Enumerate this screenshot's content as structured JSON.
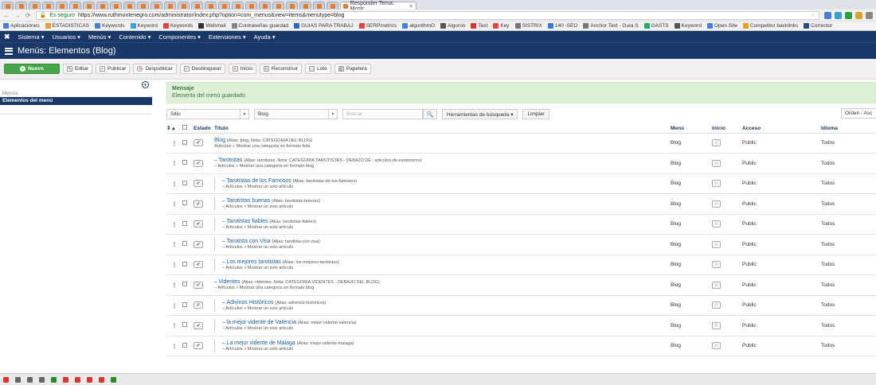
{
  "browser": {
    "active_tab": "Responder Tema: Mostr",
    "url_secure": "Es seguro",
    "url": "https://www.ruthmontenegro.com/administrator/index.php?option=com_menus&view=items&menutype=blog",
    "bookmarks": [
      "Aplicaciones",
      "ESTADISTICAS",
      "Keywords",
      "Keyword",
      "Keywords",
      "Webmail",
      "Contraseñas guardad",
      "GUIAS PARA TRABAJ",
      "SERPmetrics",
      "algorithmO",
      "Algoroo",
      "Text",
      "Key",
      "SISTRIX",
      "140 -SEO",
      "Anchor Text - Guía S",
      "GASTS",
      "Keyword",
      "Open Site",
      "Competitor backlinks",
      "Corrector"
    ]
  },
  "menubar": {
    "logo": "✖",
    "items": [
      "Sistema ▾",
      "Usuarios ▾",
      "Menús ▾",
      "Contenido ▾",
      "Componentes ▾",
      "Extensiones ▾",
      "Ayuda ▾"
    ]
  },
  "page": {
    "title": "Menús: Elementos (Blog)"
  },
  "toolbar": {
    "new": "Nuevo",
    "edit": "Editar",
    "publish": "Publicar",
    "unpublish": "Despublicar",
    "unlock": "Desbloquear",
    "home": "Inicio",
    "rebuild": "Reconstruir",
    "batch": "Lote",
    "trash": "Papelera"
  },
  "sidebar": {
    "heading": "Menús",
    "active_item": "Elementos del menú"
  },
  "alert": {
    "title": "Mensaje",
    "text": "Elemento del menú guardado"
  },
  "filters": {
    "site": "Sitio",
    "menu": "Blog",
    "search_placeholder": "Buscar",
    "search_tools": "Herramientas de búsqueda ▾",
    "clear": "Limpiar",
    "order": "Orden - Asc"
  },
  "table": {
    "headers": {
      "order": "⇕ ▴",
      "status": "Estado",
      "title": "Título",
      "menu": "Menú",
      "home": "Inicio",
      "access": "Acceso",
      "language": "Idioma"
    },
    "rows": [
      {
        "prefix": "",
        "title": "Blog",
        "alias": "(Alias: blog, Nota: CATEGORIA DEL BLOG)",
        "sub": "Artículos » Mostrar una categoría en formato lista",
        "menu": "Blog",
        "access": "Public",
        "lang": "Todos",
        "level": 0
      },
      {
        "prefix": "– ",
        "title": "Tarotistas",
        "alias": "(Alias: tarotistas, Nota: CATEGORIA TAROTISTAS - DEBAJO DE : articulos-de-esoterismo)",
        "sub": "– Artículos » Mostrar una categoría en formato blog",
        "menu": "Blog",
        "access": "Public",
        "lang": "Todos",
        "level": 0
      },
      {
        "prefix": "– ",
        "title": "Tarotistas de los Famosos",
        "alias": "(Alias: tarotistas-de-los-famosos)",
        "sub": "– Artículos » Mostrar un solo artículo",
        "menu": "Blog",
        "access": "Public",
        "lang": "Todos",
        "level": 1
      },
      {
        "prefix": "– ",
        "title": "Tarotistas buenas",
        "alias": "(Alias: tarotistas-buenas)",
        "sub": "– Artículos » Mostrar un solo artículo",
        "menu": "Blog",
        "access": "Public",
        "lang": "Todos",
        "level": 1
      },
      {
        "prefix": "– ",
        "title": "Tarotistas fiables",
        "alias": "(Alias: tarotistas-fiables)",
        "sub": "– Artículos » Mostrar un solo artículo",
        "menu": "Blog",
        "access": "Public",
        "lang": "Todos",
        "level": 1
      },
      {
        "prefix": "– ",
        "title": "Tarotista con Visa",
        "alias": "(Alias: tarotista-con-visa)",
        "sub": "– Artículos » Mostrar un solo artículo",
        "menu": "Blog",
        "access": "Public",
        "lang": "Todos",
        "level": 1
      },
      {
        "prefix": "– ",
        "title": "Los mejores tarotistas",
        "alias": "(Alias: los-mejores-tarotistas)",
        "sub": "– Artículos » Mostrar un solo artículo",
        "menu": "Blog",
        "access": "Public",
        "lang": "Todos",
        "level": 1
      },
      {
        "prefix": "– ",
        "title": "Videntes",
        "alias": "(Alias: videntes, Nota: CATEGORIA VIDENTES - DEBAJO DEL BLOG)",
        "sub": "– Artículos » Mostrar una categoría en formato blog",
        "menu": "Blog",
        "access": "Public",
        "lang": "Todos",
        "level": 0
      },
      {
        "prefix": "– ",
        "title": "Adivinos Históricos",
        "alias": "(Alias: adivinos-historicos)",
        "sub": "– Artículos » Mostrar un solo artículo",
        "menu": "Blog",
        "access": "Public",
        "lang": "Todos",
        "level": 1
      },
      {
        "prefix": "– ",
        "title": "la mejor vidente de Valencia",
        "alias": "(Alias: mejor-vidente-valencia)",
        "sub": "– Artículos » Mostrar un solo artículo",
        "menu": "Blog",
        "access": "Public",
        "lang": "Todos",
        "level": 1
      },
      {
        "prefix": "– ",
        "title": "La mejor vidente de Málaga",
        "alias": "(Alias: mejor-vidente-malaga)",
        "sub": "– Artículos » Mostrar un solo artículo",
        "menu": "Blog",
        "access": "Public",
        "lang": "Todos",
        "level": 1
      }
    ]
  },
  "colors": {
    "navy": "#1a3867",
    "green": "#46a546",
    "alert_bg": "#dff0d8"
  }
}
